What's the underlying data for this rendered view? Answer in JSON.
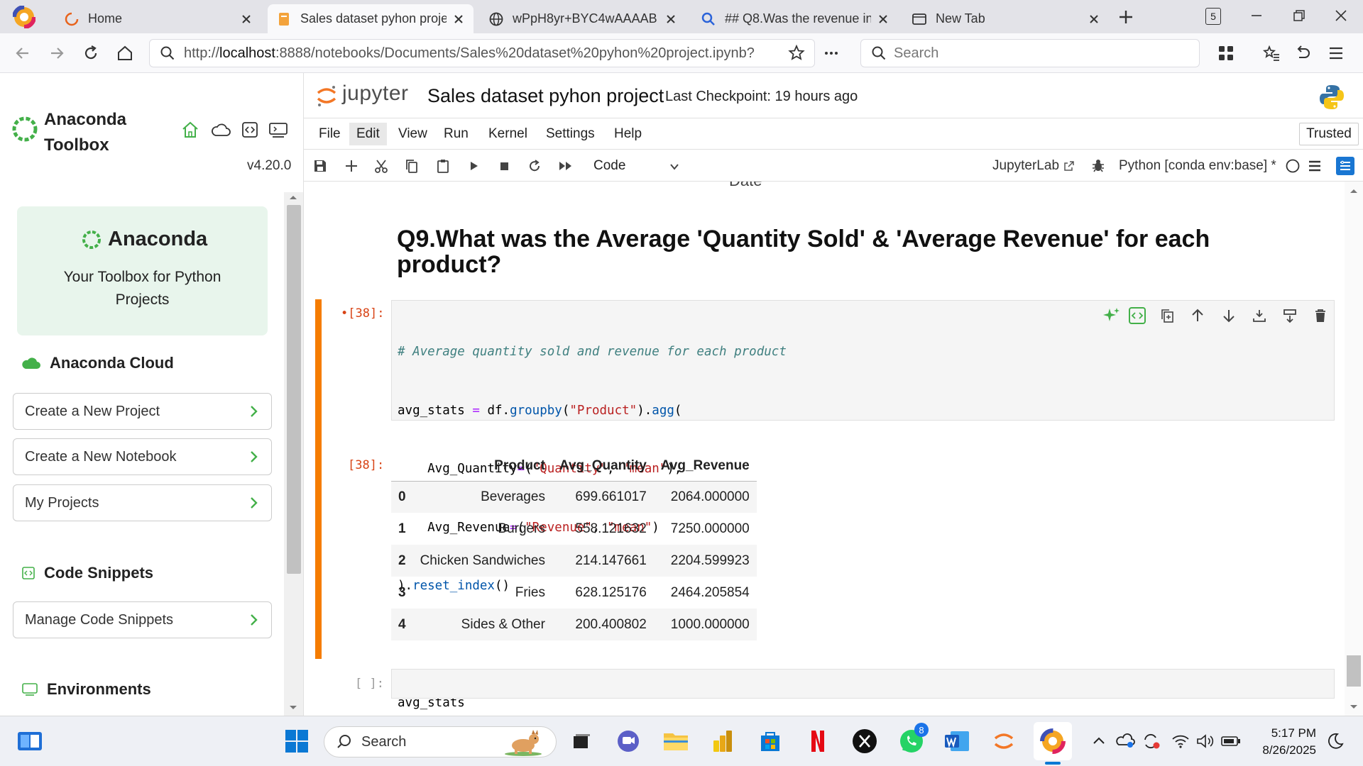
{
  "browser": {
    "tabs": [
      {
        "label": "Home",
        "icon": "loading-spinner-icon"
      },
      {
        "label": "Sales dataset pyhon proje",
        "icon": "notebook-icon",
        "active": true
      },
      {
        "label": "wPpH8yr+BYC4wAAAAB",
        "icon": "globe-icon"
      },
      {
        "label": "## Q8.Was the revenue in",
        "icon": "search-icon"
      },
      {
        "label": "New Tab",
        "icon": "new-tab-icon"
      }
    ],
    "tab_count": "5",
    "url_prefix": "http://",
    "url_host": "localhost",
    "url_rest": ":8888/notebooks/Documents/Sales%20dataset%20pyhon%20project.ipynb?",
    "search_placeholder": "Search"
  },
  "sidebar": {
    "brand_line1": "Anaconda",
    "brand_line2": "Toolbox",
    "version": "v4.20.0",
    "hero_logo": "Anaconda",
    "hero_tagline_line1": "Your Toolbox for Python",
    "hero_tagline_line2": "Projects",
    "cloud_heading": "Anaconda Cloud",
    "cloud_items": [
      "Create a New Project",
      "Create a New Notebook",
      "My Projects"
    ],
    "snippets_heading": "Code Snippets",
    "snippets_items": [
      "Manage Code Snippets"
    ],
    "env_heading": "Environments"
  },
  "jupyter": {
    "logo_text": "jupyter",
    "notebook_title": "Sales dataset pyhon project",
    "checkpoint": "Last Checkpoint: 19 hours ago",
    "trusted": "Trusted",
    "menu": [
      "File",
      "Edit",
      "View",
      "Run",
      "Kernel",
      "Settings",
      "Help"
    ],
    "cell_type": "Code",
    "jupyterlab_link": "JupyterLab",
    "kernel": "Python [conda env:base] *"
  },
  "notebook": {
    "partial_text": "Date",
    "heading_line1": "Q9.What was the Average 'Quantity Sold' & 'Average Revenue' for each",
    "heading_line2": "product?",
    "in_prompt": "[38]:",
    "in_marker": "•",
    "out_prompt": "[38]:",
    "empty_prompt": "[ ]:",
    "code": {
      "comment": "# Average quantity sold and revenue for each product",
      "l2a": "avg_stats ",
      "l2b": "=",
      "l2c": " df.",
      "l2d": "groupby",
      "l2e": "(",
      "l2f": "\"Product\"",
      "l2g": ").",
      "l2h": "agg",
      "l2i": "(",
      "l3a": "    Avg_Quantity",
      "l3b": "=",
      "l3c": "(",
      "l3d": "\"Quantity\"",
      "l3e": ", ",
      "l3f": "\"mean\"",
      "l3g": "),",
      "l4a": "    Avg_Revenue",
      "l4b": "=",
      "l4c": "(",
      "l4d": "\"Revenue\"",
      "l4e": ", ",
      "l4f": "\"mean\"",
      "l4g": ")",
      "l5a": ").",
      "l5b": "reset_index",
      "l5c": "()",
      "l7": "avg_stats"
    },
    "table": {
      "columns": [
        "",
        "Product",
        "Avg_Quantity",
        "Avg_Revenue"
      ],
      "rows": [
        [
          "0",
          "Beverages",
          "699.661017",
          "2064.000000"
        ],
        [
          "1",
          "Burgers",
          "558.121632",
          "7250.000000"
        ],
        [
          "2",
          "Chicken Sandwiches",
          "214.147661",
          "2204.599923"
        ],
        [
          "3",
          "Fries",
          "628.125176",
          "2464.205854"
        ],
        [
          "4",
          "Sides & Other",
          "200.400802",
          "1000.000000"
        ]
      ]
    }
  },
  "taskbar": {
    "search_placeholder": "Search",
    "whatsapp_badge": "8",
    "time": "5:17 PM",
    "date": "8/26/2025"
  },
  "colors": {
    "anaconda_green": "#43b049",
    "jupyter_orange": "#f37726",
    "cell_marker": "#f57c00"
  }
}
